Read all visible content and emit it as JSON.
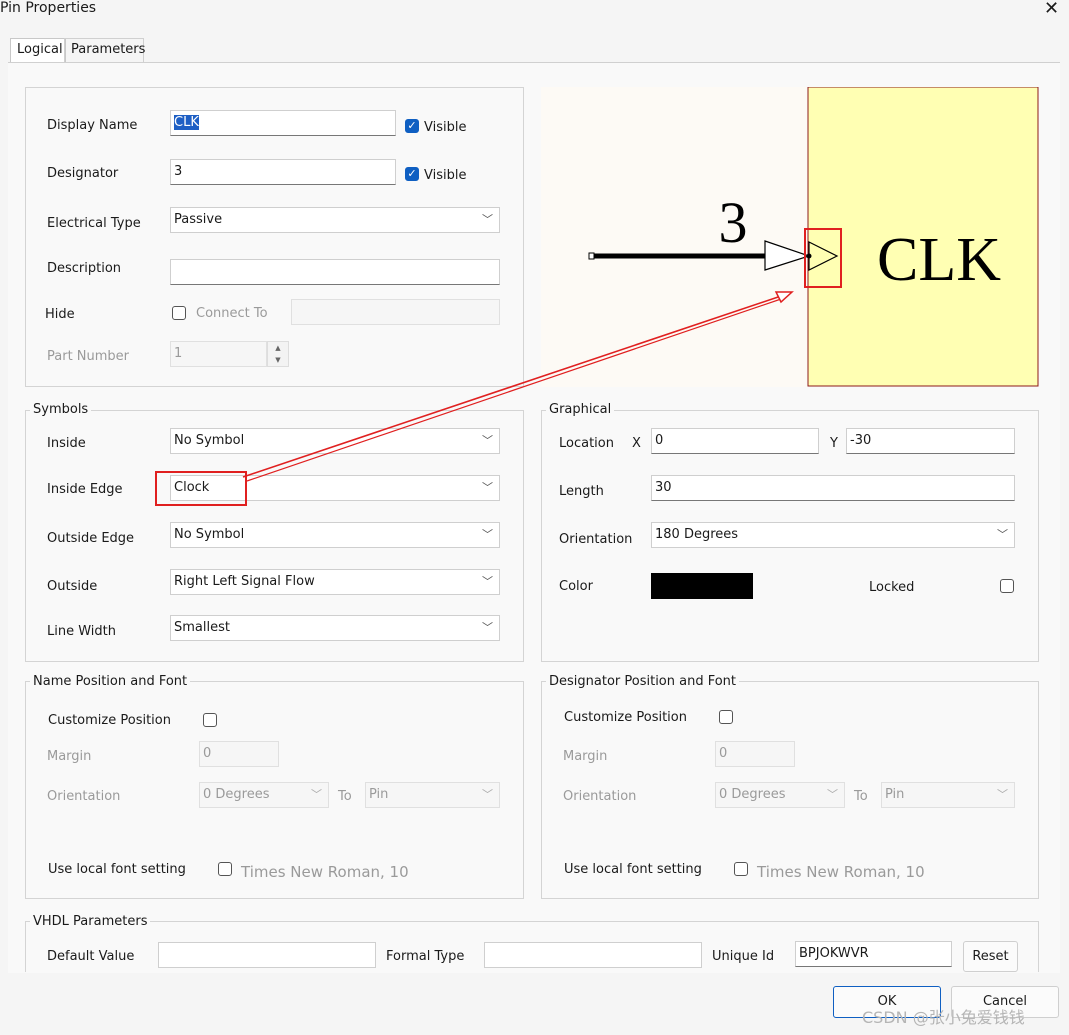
{
  "window": {
    "title": "Pin Properties",
    "close": "✕"
  },
  "tabs": [
    {
      "label": "Logical"
    },
    {
      "label": "Parameters"
    }
  ],
  "logical": {
    "display_name_label": "Display Name",
    "display_name_value": "CLK",
    "visible_label": "Visible",
    "designator_label": "Designator",
    "designator_value": "3",
    "electrical_type_label": "Electrical Type",
    "electrical_type_value": "Passive",
    "description_label": "Description",
    "description_value": "",
    "hide_label": "Hide",
    "connect_to_label": "Connect To",
    "part_number_label": "Part Number",
    "part_number_value": "1"
  },
  "preview": {
    "designator_text": "3",
    "name_text": "CLK"
  },
  "symbols": {
    "title": "Symbols",
    "inside_label": "Inside",
    "inside_value": "No Symbol",
    "inside_edge_label": "Inside Edge",
    "inside_edge_value": "Clock",
    "outside_edge_label": "Outside Edge",
    "outside_edge_value": "No Symbol",
    "outside_label": "Outside",
    "outside_value": "Right Left Signal Flow",
    "line_width_label": "Line Width",
    "line_width_value": "Smallest"
  },
  "graphical": {
    "title": "Graphical",
    "location_label": "Location",
    "x_label": "X",
    "x_value": "0",
    "y_label": "Y",
    "y_value": "-30",
    "length_label": "Length",
    "length_value": "30",
    "orientation_label": "Orientation",
    "orientation_value": "180 Degrees",
    "color_label": "Color",
    "color_value": "#000000",
    "locked_label": "Locked"
  },
  "name_font": {
    "title": "Name Position and Font",
    "customize_label": "Customize Position",
    "margin_label": "Margin",
    "margin_value": "0",
    "orientation_label": "Orientation",
    "orientation_value": "0 Degrees",
    "to_label": "To",
    "to_value": "Pin",
    "local_font_label": "Use local font setting",
    "font_value": "Times New Roman, 10"
  },
  "designator_font": {
    "title": "Designator Position and Font",
    "customize_label": "Customize Position",
    "margin_label": "Margin",
    "margin_value": "0",
    "orientation_label": "Orientation",
    "orientation_value": "0 Degrees",
    "to_label": "To",
    "to_value": "Pin",
    "local_font_label": "Use local font setting",
    "font_value": "Times New Roman, 10"
  },
  "vhdl": {
    "title": "VHDL Parameters",
    "default_value_label": "Default Value",
    "formal_type_label": "Formal Type",
    "unique_id_label": "Unique Id",
    "unique_id_value": "BPJOKWVR",
    "reset_label": "Reset"
  },
  "footer": {
    "ok_label": "OK",
    "cancel_label": "Cancel"
  },
  "watermark": "CSDN @张小兔爱钱钱",
  "colors": {
    "highlight": "#e02020",
    "preview_fill": "#ffffb3",
    "checkbox": "#0f5fc2"
  }
}
